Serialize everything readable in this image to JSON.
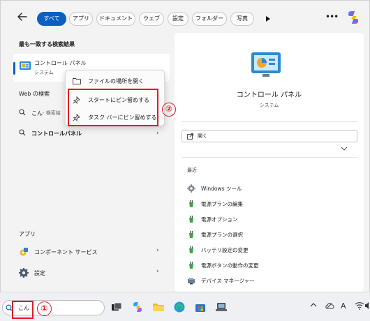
{
  "filters": {
    "chips": [
      "すべて",
      "アプリ",
      "ドキュメント",
      "ウェブ",
      "設定",
      "フォルダー",
      "写真"
    ],
    "active_index": 0
  },
  "left": {
    "best_match_title": "最も一致する検索結果",
    "best_match": {
      "name": "コントロール パネル",
      "type": "システム"
    },
    "web_title": "Web の検索",
    "web_results": [
      {
        "query": "こん",
        "suffix": " - 検索結"
      },
      {
        "query": "コントロールパネル",
        "suffix": ""
      }
    ],
    "apps_title": "アプリ",
    "apps": [
      {
        "name": "コンポーネント サービス",
        "icon": "component-services-icon"
      },
      {
        "name": "設定",
        "icon": "gear-icon"
      }
    ]
  },
  "context_menu": {
    "items": [
      {
        "label": "ファイルの場所を開く",
        "icon": "folder-icon"
      },
      {
        "label": "スタートにピン留めする",
        "icon": "pin-icon"
      },
      {
        "label": "タスク バーにピン留めする",
        "icon": "pin-icon"
      }
    ]
  },
  "annotations": {
    "marker1": "①",
    "marker2": "②",
    "color": "#e01b24"
  },
  "preview": {
    "title": "コントロール パネル",
    "subtitle": "システム",
    "open_label": "開く",
    "recent_title": "最近",
    "recent": [
      {
        "label": "Windows ツール",
        "icon": "windows-tools-icon"
      },
      {
        "label": "電源プランの編集",
        "icon": "power-plan-icon"
      },
      {
        "label": "電源オプション",
        "icon": "power-plan-icon"
      },
      {
        "label": "電源プランの選択",
        "icon": "power-plan-icon"
      },
      {
        "label": "バッテリ設定の変更",
        "icon": "power-plan-icon"
      },
      {
        "label": "電源ボタンの動作の変更",
        "icon": "power-plan-icon"
      },
      {
        "label": "デバイス マネージャー",
        "icon": "device-manager-icon"
      }
    ]
  },
  "taskbar": {
    "search_value": "こん",
    "tray_font_label": "A"
  },
  "colors": {
    "accent": "#0a5fc3",
    "window_bg": "#f3f3f3",
    "annotation_red": "#e01b24"
  }
}
